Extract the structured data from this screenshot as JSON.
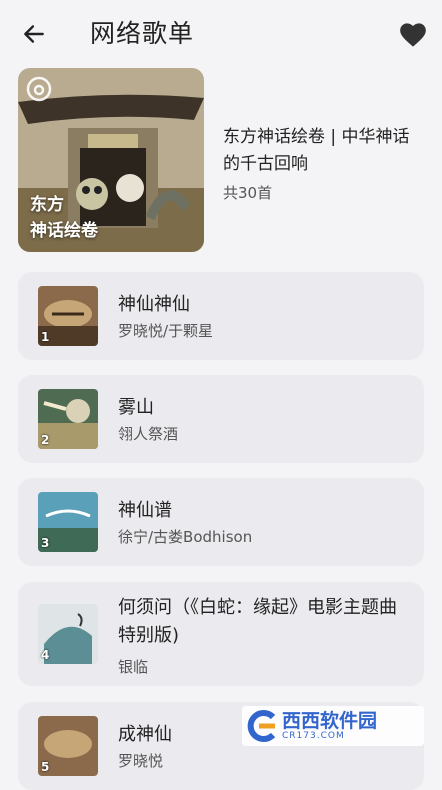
{
  "header": {
    "title": "网络歌单"
  },
  "playlist": {
    "cover_caption_line1": "东方",
    "cover_caption_line2": "神话绘卷",
    "title": "东方神话绘卷 | 中华神话的千古回响",
    "count": "共30首"
  },
  "songs": [
    {
      "index": "1",
      "title": "神仙神仙",
      "artist": "罗晓悦/于颗星"
    },
    {
      "index": "2",
      "title": "雾山",
      "artist": "翎人祭酒"
    },
    {
      "index": "3",
      "title": "神仙谱",
      "artist": "徐宁/古娄Bodhison"
    },
    {
      "index": "4",
      "title": "何须问（《白蛇：缘起》电影主题曲特别版)",
      "artist": "银临"
    },
    {
      "index": "5",
      "title": "成神仙",
      "artist": "罗晓悦"
    }
  ],
  "watermark": {
    "name": "西西软件园",
    "url": "CR173.COM"
  },
  "icons": {
    "back": "arrow-left-icon",
    "favorite": "heart-icon",
    "cover_logo": "netease-music-logo-icon"
  },
  "colors": {
    "background": "#f4f4f6",
    "card": "#ebebef",
    "watermark_blue": "#3366cc"
  }
}
